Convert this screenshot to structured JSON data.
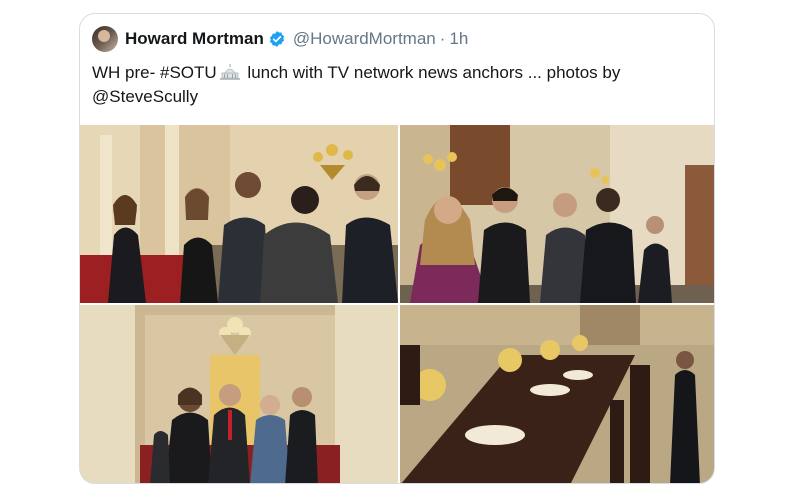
{
  "tweet": {
    "author_name": "Howard Mortman",
    "handle": "@HowardMortman",
    "separator": "·",
    "time": "1h",
    "text_part1": "WH pre- #SOTU",
    "text_part2": " lunch with TV network news anchors ... photos  by",
    "text_line2": "@SteveScully",
    "emoji": "capitol-building-icon"
  },
  "media": {
    "count": 4,
    "photos": [
      {
        "name": "photo-reception-room",
        "subject": "guests greeting in hallway"
      },
      {
        "name": "photo-anchors-talking",
        "subject": "anchors conversing under chandelier"
      },
      {
        "name": "photo-doorway-group",
        "subject": "group in doorway with chandelier"
      },
      {
        "name": "photo-lunch-table",
        "subject": "set dining table with flowers"
      }
    ]
  },
  "colors": {
    "verified": "#1da1f2",
    "secondary_text": "#657786",
    "border": "#d7dde2"
  }
}
